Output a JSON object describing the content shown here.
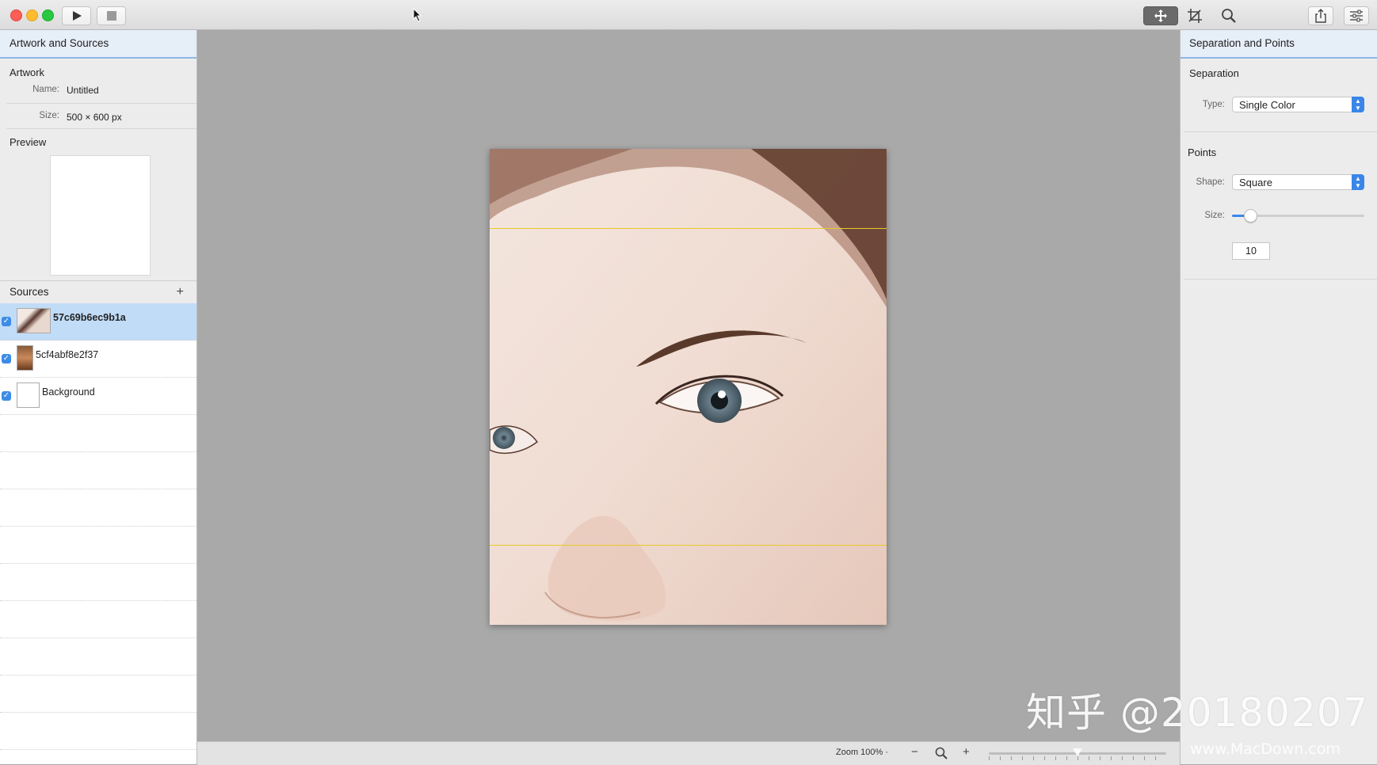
{
  "toolbar": {
    "play_icon": "play-icon",
    "stop_icon": "stop-icon",
    "tools": [
      "move-icon",
      "crop-icon",
      "zoom-icon"
    ],
    "share_icon": "share-icon",
    "sidebar_icon": "sliders-icon"
  },
  "left_panel": {
    "title": "Artwork and Sources",
    "artwork_section": "Artwork",
    "name_label": "Name:",
    "name_value": "Untitled",
    "size_label": "Size:",
    "size_value": "500 × 600 px",
    "preview_section": "Preview",
    "sources_title": "Sources",
    "add_label": "+",
    "sources": [
      {
        "name": "57c69b6ec9b1a",
        "checked": true,
        "selected": true
      },
      {
        "name": "5cf4abf8e2f37",
        "checked": true,
        "selected": false
      },
      {
        "name": "Background",
        "checked": true,
        "selected": false
      }
    ]
  },
  "canvas": {
    "zoom_label": "Zoom 100% ·",
    "zoom_out": "−",
    "zoom_in": "+",
    "zoom_level": 0.5
  },
  "right_panel": {
    "title": "Separation and Points",
    "separation_section": "Separation",
    "type_label": "Type:",
    "type_value": "Single Color",
    "points_section": "Points",
    "shape_label": "Shape:",
    "shape_value": "Square",
    "size_label": "Size:",
    "size_value": "10",
    "size_slider_level": 0.13
  },
  "watermark": {
    "main": "知乎 @20180207",
    "secondary": "www.MacDown.com"
  },
  "colors": {
    "accent": "#3a86e8",
    "selection": "#c1dcf7",
    "guide": "#e8c82a"
  }
}
